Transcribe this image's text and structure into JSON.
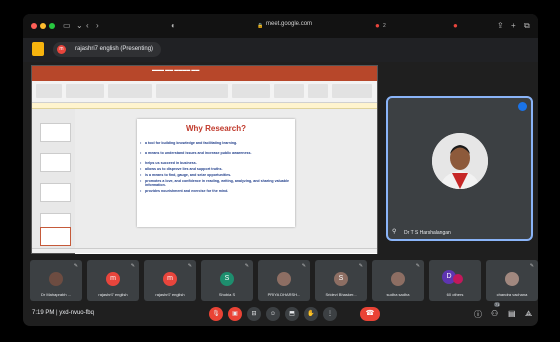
{
  "browser": {
    "url": "meet.google.com",
    "tab_count": "2",
    "colors": {
      "close": "#ff5f57",
      "minimize": "#febc2e",
      "maximize": "#28c840"
    }
  },
  "presenting": {
    "label": "rajashri7 english (Presenting)",
    "avatar_letter": "m"
  },
  "slide": {
    "title": "Why Research?",
    "bullets": [
      "a tool for building knowledge and facilitating learning.",
      "a means to understand issues and increase public awareness.",
      "helps us succeed in business.",
      "allows us to disprove lies and support truths.",
      "is a means to find, gauge, and seize opportunities.",
      "promotes a love, and confidence in reading, writing, analyzing, and sharing valuable information.",
      "provides nourishment and exercise for the mind."
    ]
  },
  "presenter": {
    "name": "Dr T S Harshalangan",
    "accent": "#8ab4f8"
  },
  "participants": [
    {
      "name": "Dr Mahaprabh ...",
      "initial": "",
      "color": "#6d4c41",
      "photo": true
    },
    {
      "name": "rajashri7 english",
      "initial": "m",
      "color": "#e8453c",
      "photo": false
    },
    {
      "name": "rajashri7 english",
      "initial": "m",
      "color": "#e8453c",
      "photo": false
    },
    {
      "name": "Shobia S",
      "initial": "S",
      "color": "#1e8e6e",
      "photo": false
    },
    {
      "name": "PRIYA DHARSH...",
      "initial": "",
      "color": "#8d6e63",
      "photo": true
    },
    {
      "name": "Sridevi Bhasker...",
      "initial": "S",
      "color": "#8d6e63",
      "photo": false
    },
    {
      "name": "sudha sadha",
      "initial": "",
      "color": "#8d6e63",
      "photo": true
    },
    {
      "name": "60 others",
      "initial": "D",
      "color": "#5e35b1",
      "photo": false
    },
    {
      "name": "chandra vachana",
      "initial": "",
      "color": "#a1887f",
      "photo": true
    }
  ],
  "footer": {
    "time": "7:19 PM",
    "meeting_code": "yxd-nvuo-fbq",
    "separator": "|",
    "participants_badge": "71"
  }
}
